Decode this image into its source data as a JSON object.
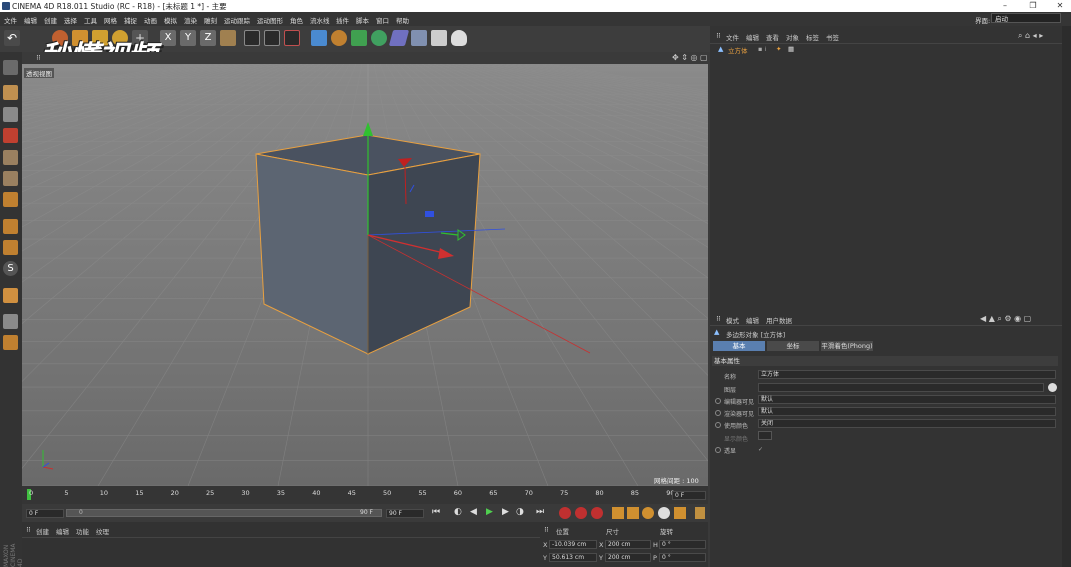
{
  "window": {
    "title": "CINEMA 4D R18.011 Studio (RC - R18) - [未标题 1 *] - 主要",
    "minimize": "–",
    "maximize": "❐",
    "close": "✕"
  },
  "menu": [
    "文件",
    "编辑",
    "创建",
    "选择",
    "工具",
    "网格",
    "捕捉",
    "动画",
    "模拟",
    "渲染",
    "雕刻",
    "运动跟踪",
    "运动图形",
    "角色",
    "流水线",
    "插件",
    "脚本",
    "窗口",
    "帮助"
  ],
  "layout": {
    "label": "界面:",
    "value": "启动"
  },
  "watermark": "秒懂视频",
  "viewport": {
    "title": "透视视图",
    "grid_spacing": "网格间距 : 100 cm"
  },
  "timeline": {
    "ticks": [
      "0",
      "5",
      "10",
      "15",
      "20",
      "25",
      "30",
      "35",
      "40",
      "45",
      "50",
      "55",
      "60",
      "65",
      "70",
      "75",
      "80",
      "85",
      "90"
    ],
    "current_frame": "0 F"
  },
  "transport": {
    "start": "0 F",
    "range_end": "90 F",
    "end": "90 F",
    "inner_start": "0"
  },
  "material_panel": {
    "tabs": [
      "创建",
      "编辑",
      "功能",
      "纹理"
    ]
  },
  "coord_panel": {
    "headers": [
      "位置",
      "尺寸",
      "旋转"
    ],
    "rows": [
      {
        "axis": "X",
        "pos": "-10.039 cm",
        "size_axis": "X",
        "size": "200 cm",
        "rot_axis": "H",
        "rot": "0 °"
      },
      {
        "axis": "Y",
        "pos": "50.613 cm",
        "size_axis": "Y",
        "size": "200 cm",
        "rot_axis": "P",
        "rot": "0 °"
      }
    ]
  },
  "object_panel": {
    "tabs": [
      "文件",
      "编辑",
      "查看",
      "对象",
      "标签",
      "书签"
    ],
    "object_name": "立方体"
  },
  "attr_panel": {
    "tabs": [
      "模式",
      "编辑",
      "用户数据"
    ],
    "object_title": "多边形对象 [立方体]",
    "subtabs": [
      "基本",
      "坐标",
      "平滑着色(Phong)"
    ],
    "section": "基本属性",
    "rows": [
      {
        "label": "名称",
        "value": "立方体"
      },
      {
        "label": "图层",
        "value": ""
      },
      {
        "label": "编辑器可见",
        "value": "默认"
      },
      {
        "label": "渲染器可见",
        "value": "默认"
      },
      {
        "label": "使用颜色",
        "value": "关闭"
      },
      {
        "label": "显示颜色",
        "value": ""
      },
      {
        "label": "透显",
        "value": ""
      }
    ]
  },
  "side_label": "MAXON CINEMA 4D",
  "colors": {
    "accent": "#5a7fb0",
    "selection_orange": "#e8a040",
    "axis_x": "#d03030",
    "axis_y": "#30c030",
    "axis_z": "#3050e0"
  }
}
